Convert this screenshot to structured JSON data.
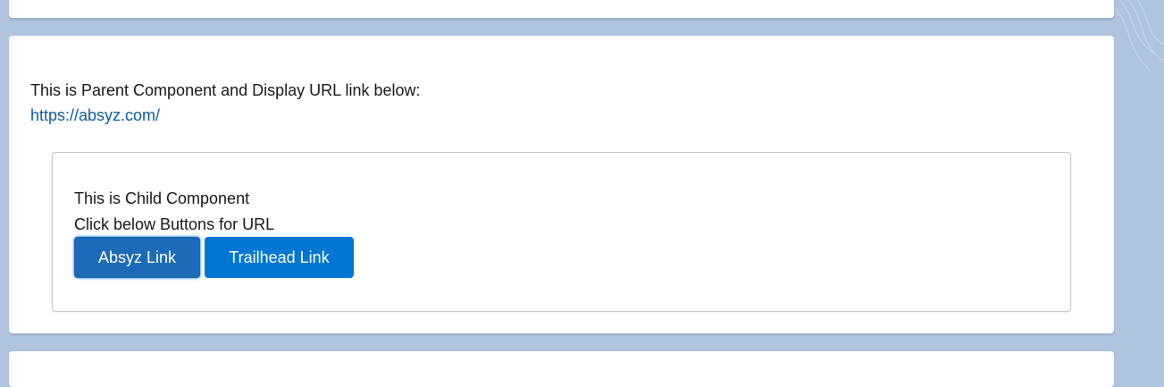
{
  "parent": {
    "text": "This is Parent Component and Display URL link below:",
    "link": "https://absyz.com/"
  },
  "child": {
    "line1": "This is Child Component",
    "line2": "Click below Buttons for URL",
    "buttons": {
      "absyz": "Absyz Link",
      "trailhead": "Trailhead Link"
    }
  },
  "colors": {
    "page_background": "#b0c4df",
    "brand_button": "#0176d3",
    "link": "#0b5cab"
  }
}
